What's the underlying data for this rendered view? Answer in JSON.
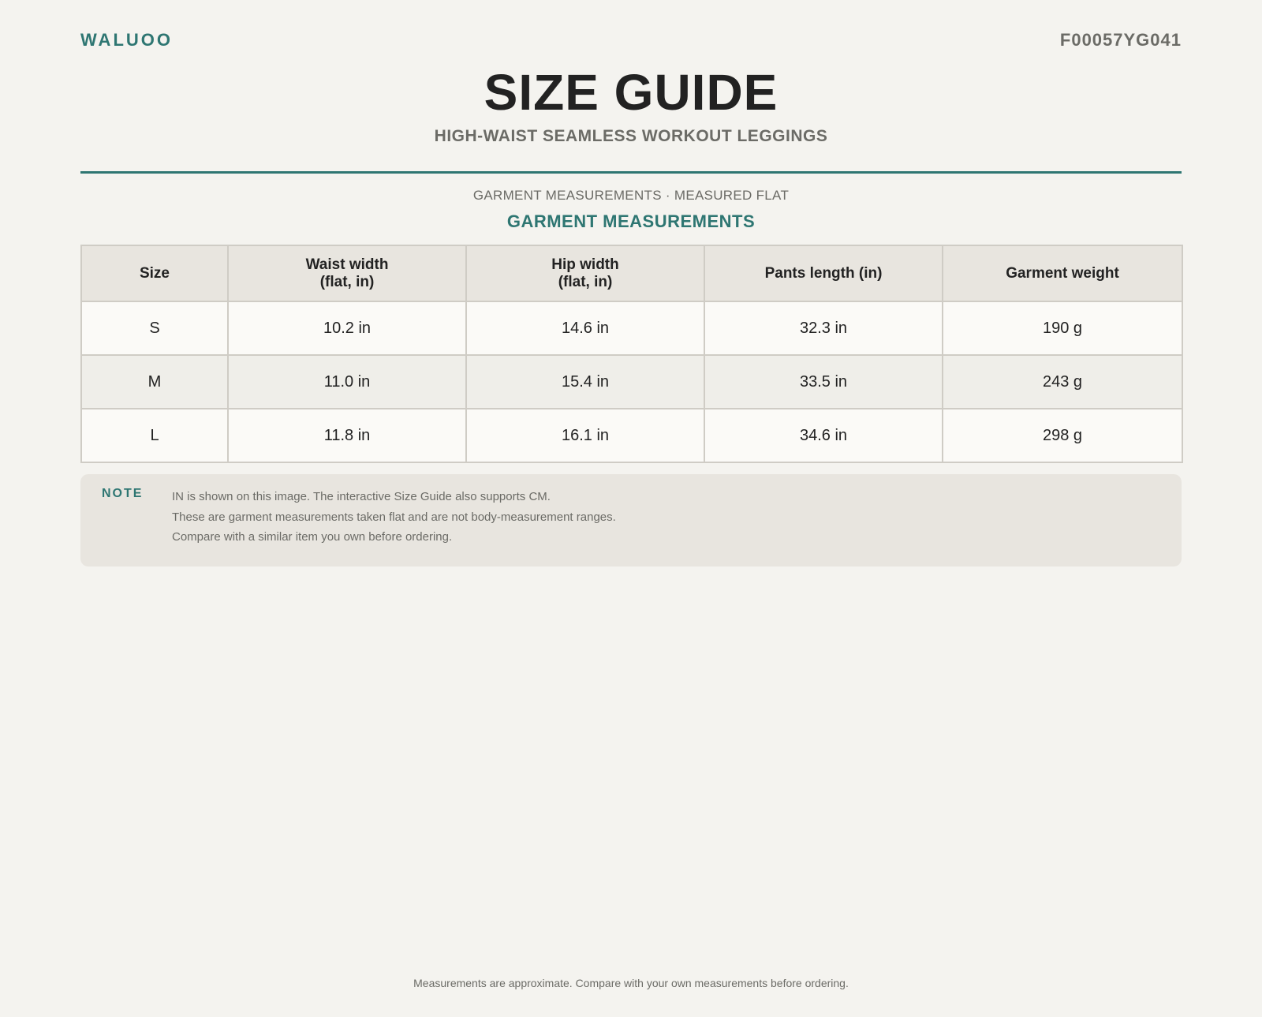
{
  "header": {
    "brand": "WALUOO",
    "product_code": "F00057YG041",
    "title": "SIZE GUIDE",
    "subtitle": "HIGH-WAIST SEAMLESS WORKOUT LEGGINGS"
  },
  "section": {
    "caption": "GARMENT MEASUREMENTS · MEASURED FLAT",
    "title": "GARMENT MEASUREMENTS"
  },
  "table": {
    "headers": [
      "Size",
      "Waist width\n(flat, in)",
      "Hip width\n(flat, in)",
      "Pants length (in)",
      "Garment weight"
    ],
    "rows": [
      [
        "S",
        "10.2 in",
        "14.6 in",
        "32.3 in",
        "190 g"
      ],
      [
        "M",
        "11.0 in",
        "15.4 in",
        "33.5 in",
        "243 g"
      ],
      [
        "L",
        "11.8 in",
        "16.1 in",
        "34.6 in",
        "298 g"
      ]
    ]
  },
  "note": {
    "label": "NOTE",
    "lines": [
      "IN is shown on this image. The interactive Size Guide also supports CM.",
      "These are garment measurements taken flat and are not body-measurement ranges.",
      "Compare with a similar item you own before ordering."
    ]
  },
  "footer": {
    "text": "Measurements are approximate. Compare with your own measurements before ordering."
  },
  "colors": {
    "accent": "#2e7672",
    "background": "#f4f3ef",
    "muted_text": "#6b6b66"
  }
}
